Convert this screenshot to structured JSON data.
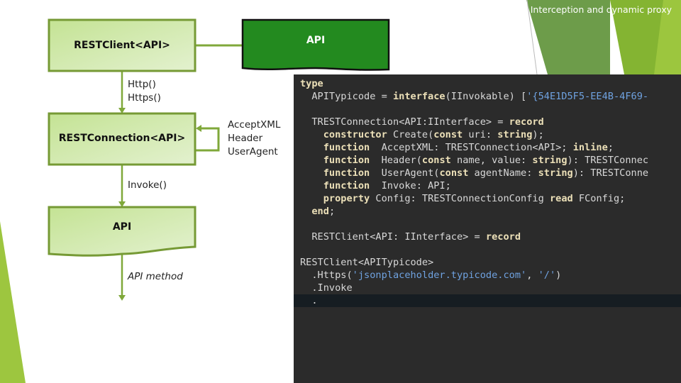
{
  "slide_title": "Interception and dynamic proxy",
  "colors": {
    "accent_green": "#7fa83a",
    "box_fill": "#d3eab0",
    "api_fill": "#238a1f",
    "code_bg": "#2b2b2b"
  },
  "diagram": {
    "rest_client": "RESTClient<API>",
    "api_top": "API",
    "http_label_1": "Http()",
    "http_label_2": "Https()",
    "rest_connection": "RESTConnection<API>",
    "self_loop_1": "AcceptXML",
    "self_loop_2": "Header",
    "self_loop_3": "UserAgent",
    "invoke_label": "Invoke()",
    "api_box": "API",
    "api_method_label": "API method"
  },
  "code": [
    [
      [
        "type",
        "kw"
      ]
    ],
    [
      [
        "  APITypicode = ",
        ""
      ],
      [
        "interface",
        "kw"
      ],
      [
        "(IInvokable) [",
        ""
      ],
      [
        "'{54E1D5F5-EE4B-4F69-",
        "str"
      ]
    ],
    [],
    [
      [
        "  TRESTConnection<API:IInterface> = ",
        ""
      ],
      [
        "record",
        "kw"
      ]
    ],
    [
      [
        "    ",
        ""
      ],
      [
        "constructor",
        "kw"
      ],
      [
        " Create(",
        ""
      ],
      [
        "const",
        "kw"
      ],
      [
        " uri: ",
        ""
      ],
      [
        "string",
        "kw"
      ],
      [
        ");",
        ""
      ]
    ],
    [
      [
        "    ",
        ""
      ],
      [
        "function",
        "kw"
      ],
      [
        "  AcceptXML: TRESTConnection<API>; ",
        ""
      ],
      [
        "inline",
        "kw"
      ],
      [
        ";",
        ""
      ]
    ],
    [
      [
        "    ",
        ""
      ],
      [
        "function",
        "kw"
      ],
      [
        "  Header(",
        ""
      ],
      [
        "const",
        "kw"
      ],
      [
        " name, value: ",
        ""
      ],
      [
        "string",
        "kw"
      ],
      [
        "): TRESTConnec",
        ""
      ]
    ],
    [
      [
        "    ",
        ""
      ],
      [
        "function",
        "kw"
      ],
      [
        "  UserAgent(",
        ""
      ],
      [
        "const",
        "kw"
      ],
      [
        " agentName: ",
        ""
      ],
      [
        "string",
        "kw"
      ],
      [
        "): TRESTConne",
        ""
      ]
    ],
    [
      [
        "    ",
        ""
      ],
      [
        "function",
        "kw"
      ],
      [
        "  Invoke: API;",
        ""
      ]
    ],
    [
      [
        "    ",
        ""
      ],
      [
        "property",
        "kw"
      ],
      [
        " Config: TRESTConnectionConfig ",
        ""
      ],
      [
        "read",
        "kw"
      ],
      [
        " FConfig;",
        ""
      ]
    ],
    [
      [
        "  ",
        ""
      ],
      [
        "end",
        "kw"
      ],
      [
        ";",
        ""
      ]
    ],
    [],
    [
      [
        "  RESTClient<API: IInterface> = ",
        ""
      ],
      [
        "record",
        "kw"
      ]
    ],
    [],
    [
      [
        "RESTClient<APITypicode>",
        ""
      ]
    ],
    [
      [
        "  .Https(",
        ""
      ],
      [
        "'jsonplaceholder.typicode.com'",
        "str"
      ],
      [
        ", ",
        ""
      ],
      [
        "'/'",
        "str"
      ],
      [
        ")",
        ""
      ]
    ],
    [
      [
        "  .Invoke",
        ""
      ]
    ],
    [
      [
        "  .",
        ""
      ]
    ]
  ]
}
